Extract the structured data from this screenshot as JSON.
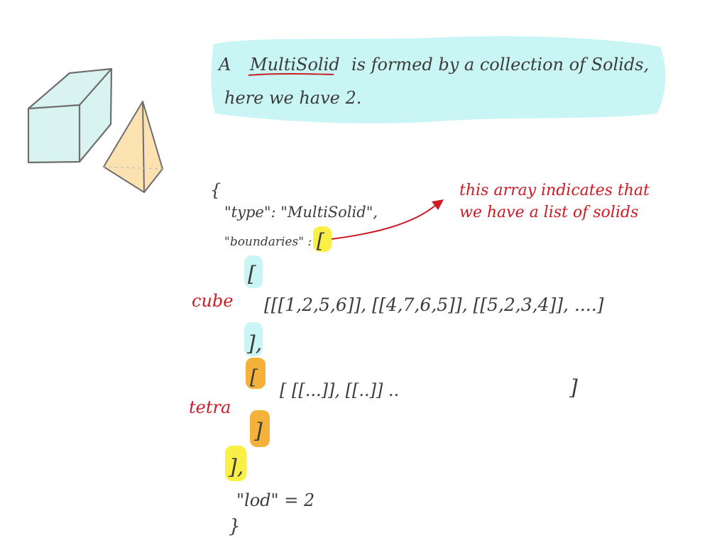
{
  "note": {
    "prefix": "A",
    "term": "MultiSolid",
    "rest": "is formed by a collection of Solids,",
    "line2": "here we have 2."
  },
  "annotation": {
    "line1": "this array indicates that",
    "line2": "we have a list of solids"
  },
  "labels": {
    "cube": "cube",
    "tetra": "tetra"
  },
  "json_sketch": {
    "open_brace": "{",
    "type_line": "\"type\": \"MultiSolid\",",
    "boundaries_key": "\"boundaries\" :",
    "outer_open": "[",
    "cube_open": "[",
    "cube_content": "[[[1,2,5,6]], [[4,7,6,5]], [[5,2,3,4]], ....]",
    "cube_close": "],",
    "tetra_open": "[",
    "tetra_content": "[  [[...]], [[..]] ..",
    "tetra_inner_close": "]",
    "tetra_close": "]",
    "outer_close": "],",
    "lod_line": "\"lod\" = 2",
    "close_brace": "}"
  },
  "colors": {
    "cyan_highlight": "#c9f5f5",
    "yellow_highlight": "#f9ef45",
    "orange_highlight": "#f4b23a",
    "red_ink": "#cc1b24",
    "cube_fill": "#d8f3f0",
    "pyramid_fill": "#fbe2b0"
  }
}
